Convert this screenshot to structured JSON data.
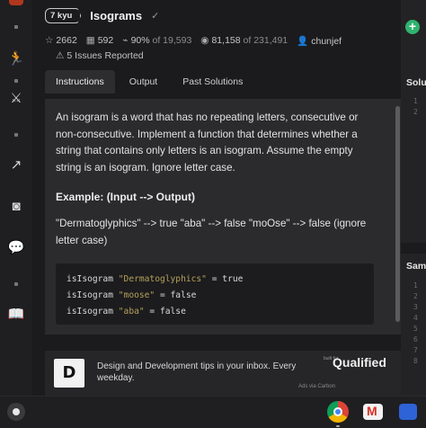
{
  "kata": {
    "rank": "7 kyu",
    "title": "Isograms",
    "check_icon": "check-icon",
    "stats": {
      "stars": "2662",
      "collections": "592",
      "satisfaction": "90%",
      "satisfaction_of": "of 19,593",
      "completions": "81,158",
      "completions_of": "of 231,491",
      "author": "chunjef"
    },
    "issues": "5 Issues Reported"
  },
  "tabs": [
    {
      "label": "Instructions"
    },
    {
      "label": "Output"
    },
    {
      "label": "Past Solutions"
    }
  ],
  "description": {
    "paragraph": "An isogram is a word that has no repeating letters, consecutive or non-consecutive. Implement a function that determines whether a string that contains only letters is an isogram. Assume the empty string is an isogram. Ignore letter case.",
    "example_title": "Example: (Input --> Output)",
    "example_text": "\"Dermatoglyphics\" --> true \"aba\" --> false \"moOse\" --> false (ignore letter case)",
    "code": [
      {
        "fn": "isIsogram ",
        "arg": "\"Dermatoglyphics\"",
        "result": " = true"
      },
      {
        "fn": "isIsogram ",
        "arg": "\"moose\"",
        "result": " = false"
      },
      {
        "fn": "isIsogram ",
        "arg": "\"aba\"",
        "result": " = false"
      }
    ]
  },
  "ad": {
    "logo_letter": "D",
    "text": "Design and Development tips in your inbox. Every weekday.",
    "brand_pre": "built for",
    "brand": "Qualified",
    "via": "Ads via Carbon"
  },
  "right_panel": {
    "solution_header": "Solu",
    "sample_header": "Sam",
    "solution_lines": [
      "1",
      "2"
    ],
    "sample_lines": [
      "1",
      "2",
      "3",
      "4",
      "5",
      "6",
      "7",
      "8"
    ]
  },
  "colors": {
    "accent_green": "#2fb36e",
    "code_string": "#b5a05a",
    "brand_red": "#b1361e"
  }
}
